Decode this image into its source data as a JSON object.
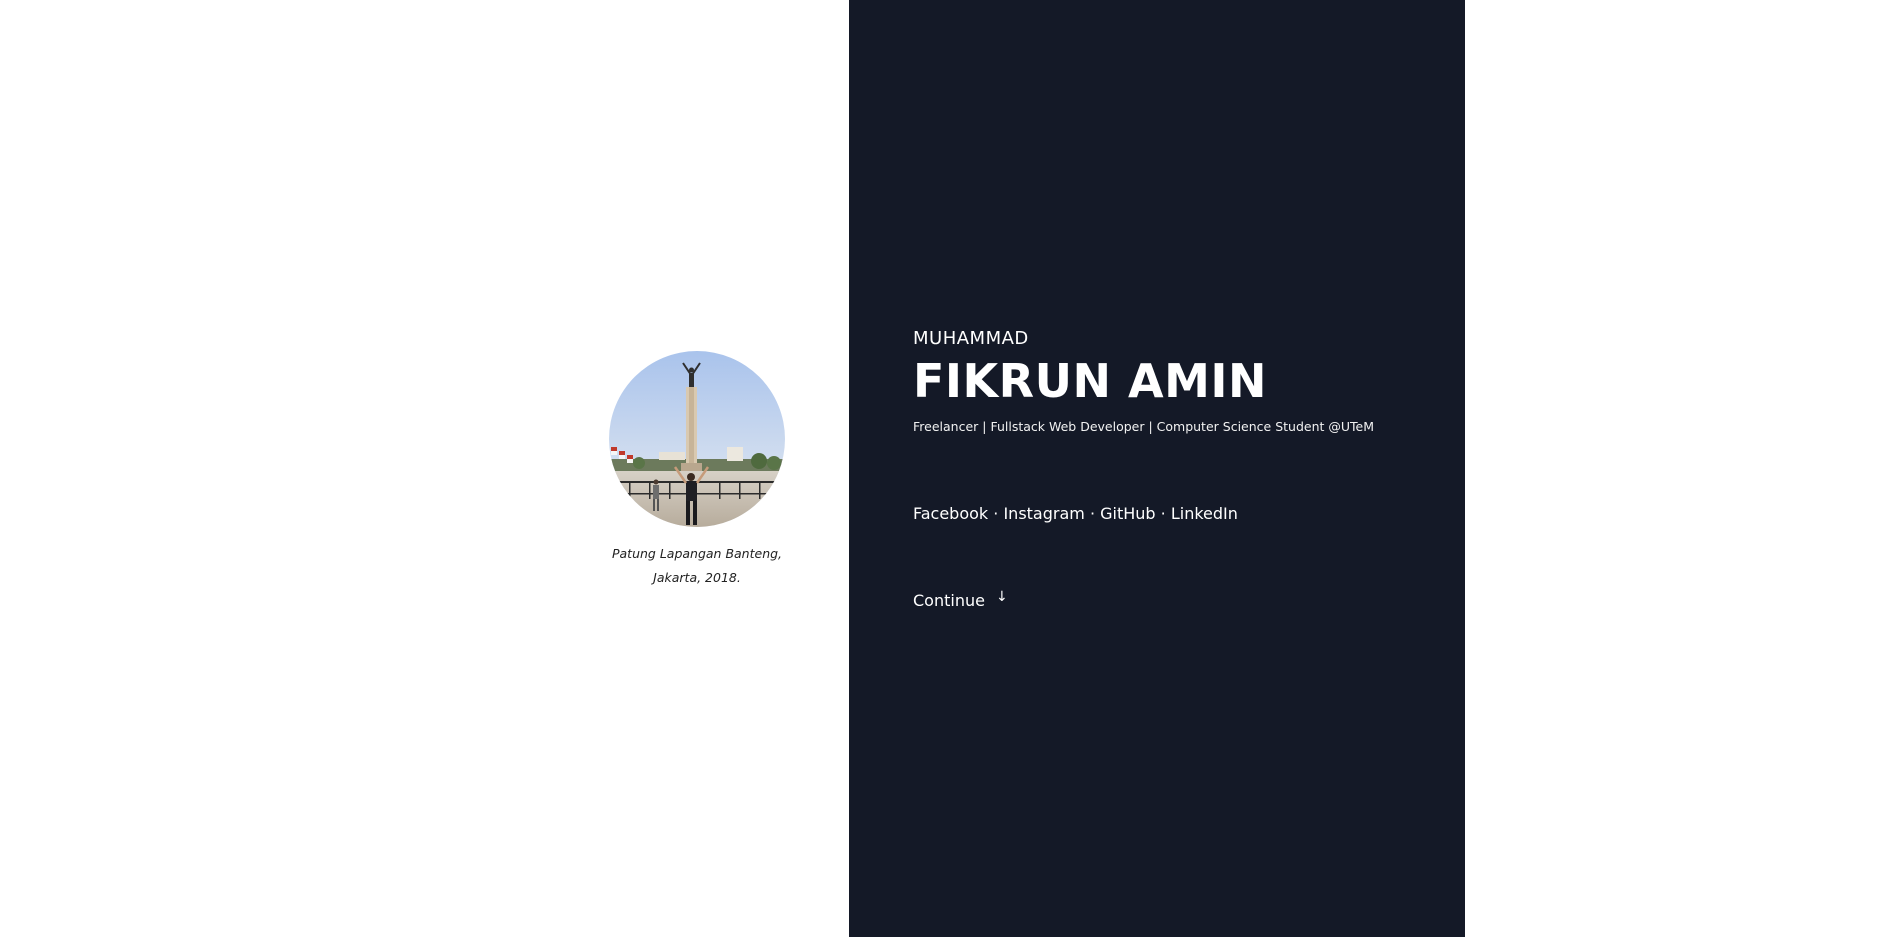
{
  "profile": {
    "photo_caption_line1": "Patung Lapangan Banteng,",
    "photo_caption_line2": "Jakarta, 2018."
  },
  "hero": {
    "first_name": "MUHAMMAD",
    "last_name": "FIKRUN AMIN",
    "tagline": "Freelancer | Fullstack Web Developer | Computer Science Student @UTeM"
  },
  "social": {
    "links": [
      "Facebook",
      "Instagram",
      "GitHub",
      "LinkedIn"
    ],
    "separator": " · "
  },
  "continue": {
    "label": "Continue",
    "arrow": "↓"
  },
  "colors": {
    "panel": "#141927",
    "text_light": "#ffffff",
    "caption_text": "#222222"
  }
}
